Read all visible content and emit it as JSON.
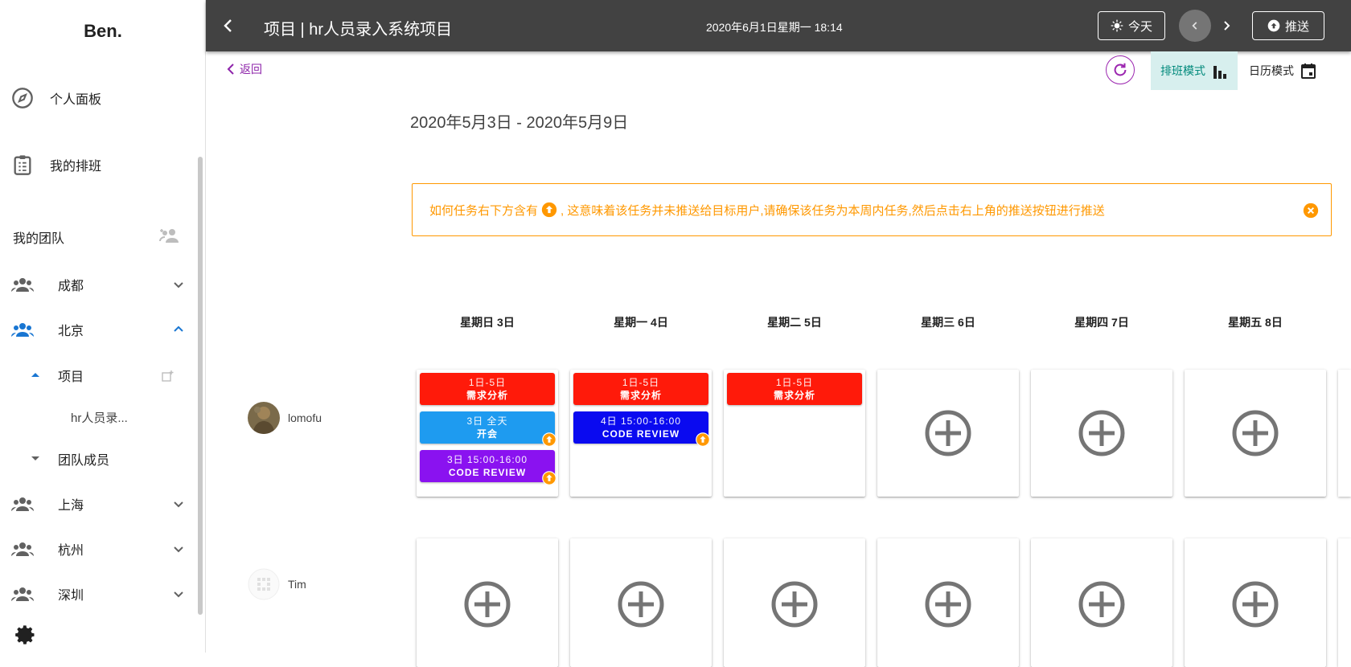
{
  "app": {
    "logo": "Ben."
  },
  "sidebar": {
    "nav": [
      {
        "label": "个人面板",
        "icon": "compass-icon"
      },
      {
        "label": "我的排班",
        "icon": "clipboard-icon"
      }
    ],
    "team_section_title": "我的团队",
    "groups": [
      {
        "label": "成都",
        "expanded": false
      },
      {
        "label": "北京",
        "expanded": true
      },
      {
        "label": "上海",
        "expanded": false
      },
      {
        "label": "杭州",
        "expanded": false
      },
      {
        "label": "深圳",
        "expanded": false
      }
    ],
    "beijing_children": {
      "projects_label": "项目",
      "project_item": "hr人员录...",
      "members_label": "团队成员"
    }
  },
  "topbar": {
    "title": "项目 | hr人员录入系统项目",
    "datetime": "2020年6月1日星期一 18:14",
    "today_label": "今天",
    "push_label": "推送"
  },
  "content": {
    "back_label": "返回",
    "mode_schedule": "排班模式",
    "mode_calendar": "日历模式",
    "week_range": "2020年5月3日 - 2020年5月9日",
    "alert_prefix": "如何任务右下方含有",
    "alert_suffix": ", 这意味着该任务并未推送给目标用户,请确保该任务为本周内任务,然后点击右上角的推送按钮进行推送",
    "days": [
      "星期日 3日",
      "星期一 4日",
      "星期二 5日",
      "星期三 6日",
      "星期四 7日",
      "星期五 8日"
    ],
    "users": [
      {
        "name": "lomofu",
        "cells": [
          [
            {
              "time": "1日-5日",
              "title": "需求分析",
              "color": "#ff1a0a",
              "unpushed": false
            },
            {
              "time": "3日 全天",
              "title": "开会",
              "color": "#1e9bf0",
              "unpushed": true
            },
            {
              "time": "3日 15:00-16:00",
              "title": "CODE REVIEW",
              "color": "#8a12f0",
              "unpushed": true
            }
          ],
          [
            {
              "time": "1日-5日",
              "title": "需求分析",
              "color": "#ff1a0a",
              "unpushed": false
            },
            {
              "time": "4日 15:00-16:00",
              "title": "CODE REVIEW",
              "color": "#0a0af0",
              "unpushed": true
            }
          ],
          [
            {
              "time": "1日-5日",
              "title": "需求分析",
              "color": "#ff1a0a",
              "unpushed": false
            }
          ],
          [],
          [],
          []
        ]
      },
      {
        "name": "Tim",
        "cells": [
          [],
          [],
          [],
          [],
          [],
          []
        ]
      }
    ]
  },
  "colors": {
    "accent": "#8e24aa",
    "warning": "#ff9800",
    "topbar": "#424242",
    "active_mode_bg": "#d7efee"
  }
}
